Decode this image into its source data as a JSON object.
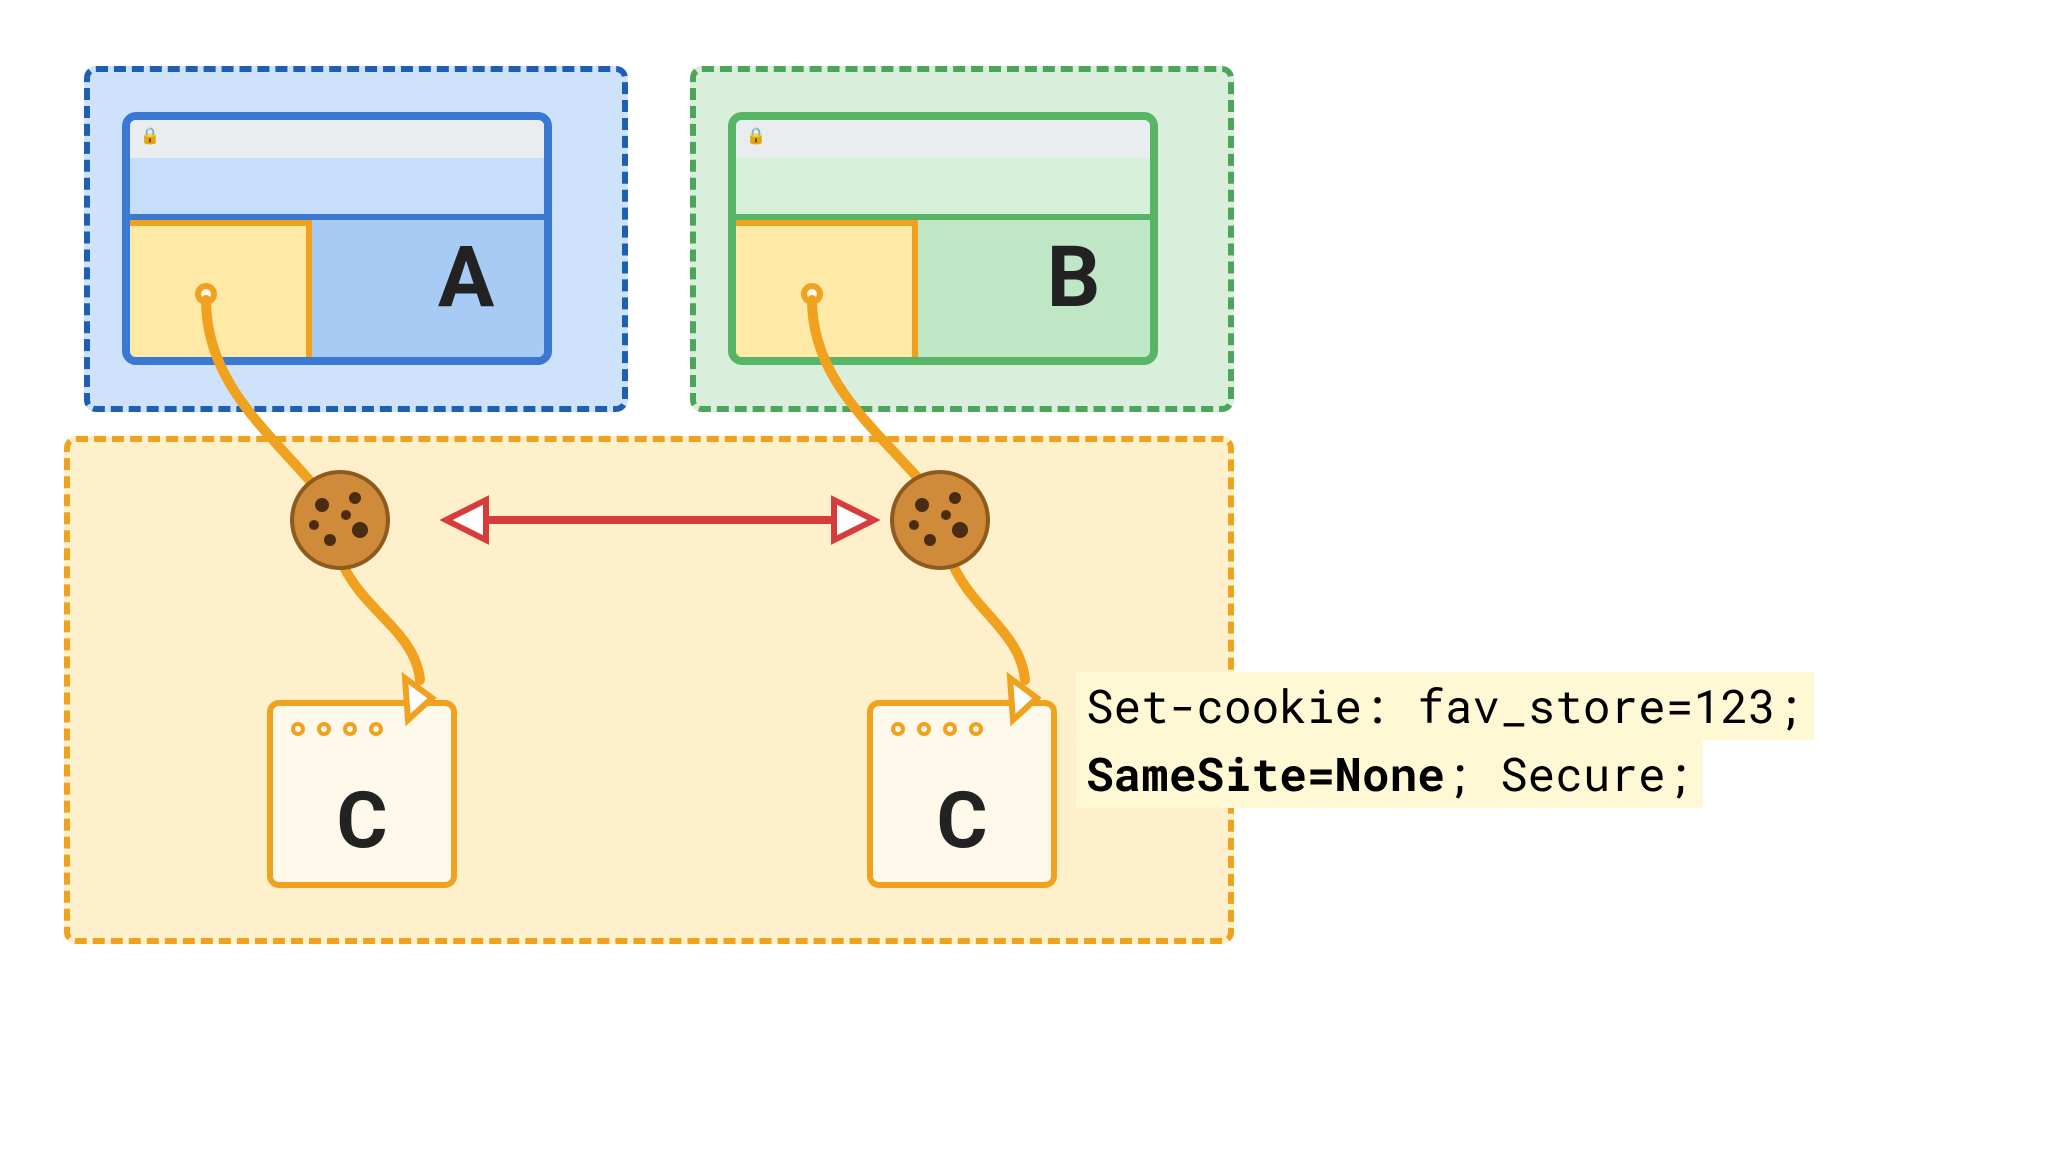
{
  "browsers": {
    "a": {
      "label": "A"
    },
    "b": {
      "label": "B"
    }
  },
  "site_c": {
    "label": "C"
  },
  "code": {
    "line1": "Set-cookie: fav_store=123;",
    "line2_bold": "SameSite=None",
    "line2_rest": "; Secure;"
  },
  "colors": {
    "blue": "#1e5fb3",
    "green": "#4da55b",
    "orange": "#f0a21e",
    "red": "#d63c3c"
  },
  "icons": {
    "cookie": "🍪",
    "lock": "🔒"
  }
}
